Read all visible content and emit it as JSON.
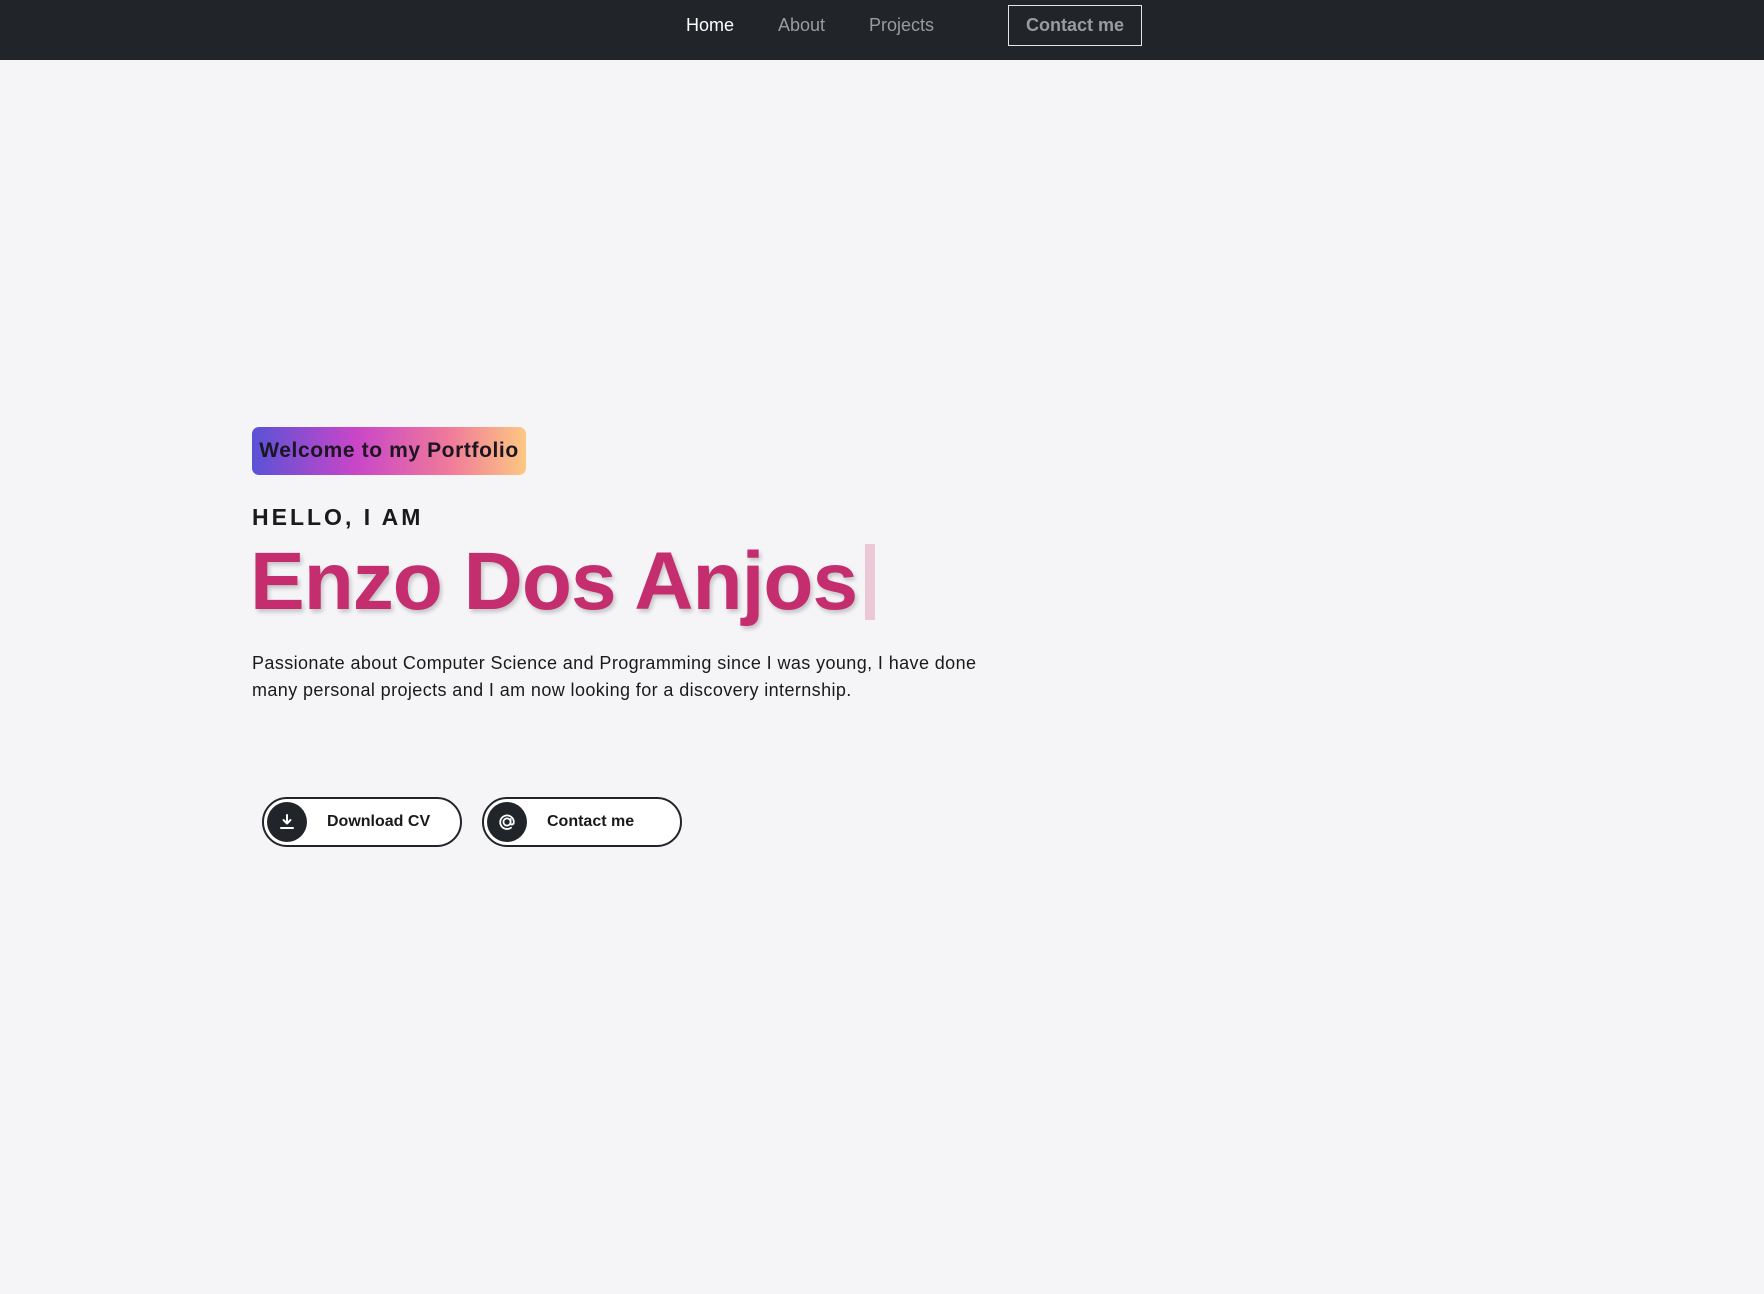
{
  "nav": {
    "home": "Home",
    "about": "About",
    "projects": "Projects",
    "contact": "Contact me"
  },
  "hero": {
    "badge": "Welcome to my Portfolio",
    "greeting": "HELLO, I AM",
    "name": "Enzo Dos Anjos",
    "bio": "Passionate about Computer Science and Programming since I was young, I have done many personal projects and I am now looking for a discovery internship."
  },
  "buttons": {
    "download": {
      "label": "Download CV",
      "icon": "download-icon"
    },
    "contact": {
      "label": "Contact me",
      "icon": "at-sign-icon"
    }
  },
  "colors": {
    "nav_bg": "#212529",
    "page_bg": "#f5f5f7",
    "name": "#c42e6e",
    "badge_gradient": [
      "#5a52d6",
      "#c946c8",
      "#f07a9a",
      "#fcc882"
    ]
  }
}
